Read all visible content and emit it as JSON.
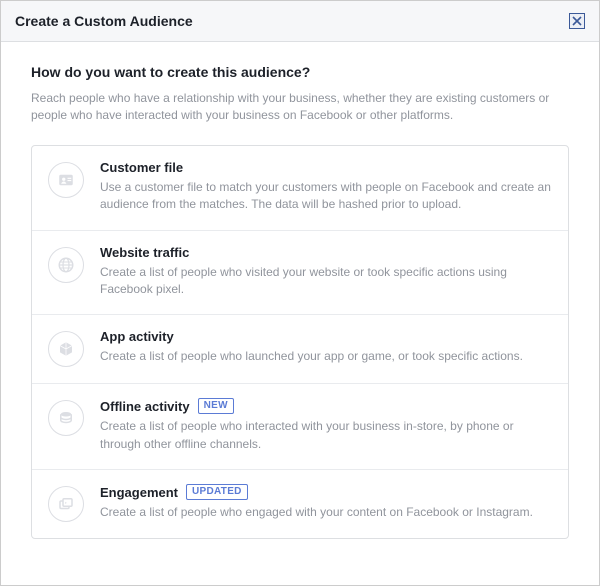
{
  "dialog": {
    "title": "Create a Custom Audience"
  },
  "body": {
    "question": "How do you want to create this audience?",
    "subtext": "Reach people who have a relationship with your business, whether they are existing customers or people who have interacted with your business on Facebook or other platforms."
  },
  "options": [
    {
      "icon": "contact-card-icon",
      "title": "Customer file",
      "badge": "",
      "desc": "Use a customer file to match your customers with people on Facebook and create an audience from the matches. The data will be hashed prior to upload."
    },
    {
      "icon": "globe-icon",
      "title": "Website traffic",
      "badge": "",
      "desc": "Create a list of people who visited your website or took specific actions using Facebook pixel."
    },
    {
      "icon": "cube-icon",
      "title": "App activity",
      "badge": "",
      "desc": "Create a list of people who launched your app or game, or took specific actions."
    },
    {
      "icon": "stack-icon",
      "title": "Offline activity",
      "badge": "NEW",
      "desc": "Create a list of people who interacted with your business in-store, by phone or through other offline channels."
    },
    {
      "icon": "engagement-icon",
      "title": "Engagement",
      "badge": "UPDATED",
      "desc": "Create a list of people who engaged with your content on Facebook or Instagram."
    }
  ]
}
